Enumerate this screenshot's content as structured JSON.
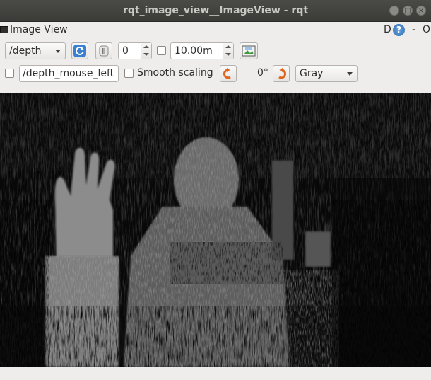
{
  "window": {
    "title": "rqt_image_view__ImageView - rqt"
  },
  "dock": {
    "title": "Image View",
    "d_label": "D",
    "help_icon": "?",
    "dash_label": "-",
    "o_label": "O"
  },
  "toolbar": {
    "topic_value": "/depth",
    "refresh_icon": "refresh-icon",
    "pause_icon": "pause-icon",
    "spin_value": "0",
    "max_range_value": "10.00m",
    "save_icon": "save-image-icon",
    "mouse_topic_value": "/depth_mouse_left",
    "smooth_scaling_label": "Smooth scaling",
    "rotate_left_icon": "rotate-left-icon",
    "rotation_value": "0°",
    "rotate_right_icon": "rotate-right-icon",
    "colormap_value": "Gray"
  },
  "image": {
    "description_kind": "depth-image",
    "colormap": "gray"
  },
  "colors": {
    "titlebar": "#3b3b38",
    "window_bg": "#efedec",
    "accent_orange": "#e0641c",
    "accent_blue": "#2d6bb3"
  }
}
